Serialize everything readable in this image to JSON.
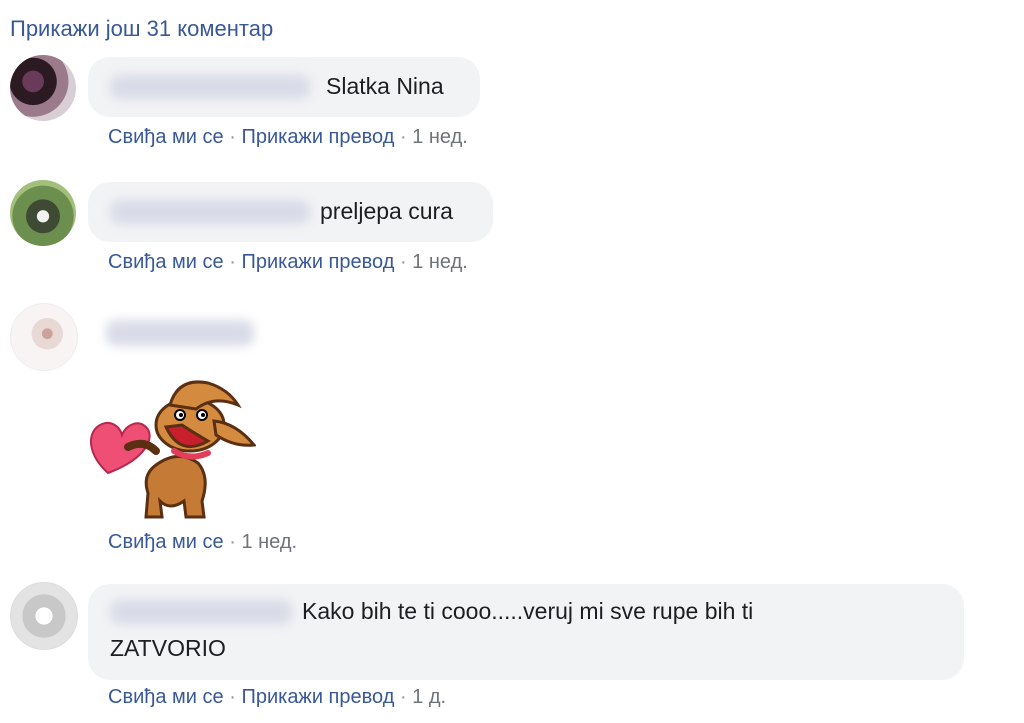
{
  "show_more": "Прикажи још 31 коментар",
  "comments": [
    {
      "text": "Slatka Nina",
      "like": "Свиђа ми се",
      "translate": "Прикажи превод",
      "time": "1 нед."
    },
    {
      "text": "preljepa cura",
      "like": "Свиђа ми се",
      "translate": "Прикажи превод",
      "time": "1 нед."
    },
    {
      "sticker": "dog-heart-sticker",
      "like": "Свиђа ми се",
      "time": "1 нед."
    },
    {
      "text_line1": "Kako bih te ti cooo.....veruj mi sve rupe bih ti",
      "text_line2": "ZATVORIO",
      "like": "Свиђа ми се",
      "translate": "Прикажи превод",
      "time": "1 д."
    }
  ],
  "separator": "·"
}
